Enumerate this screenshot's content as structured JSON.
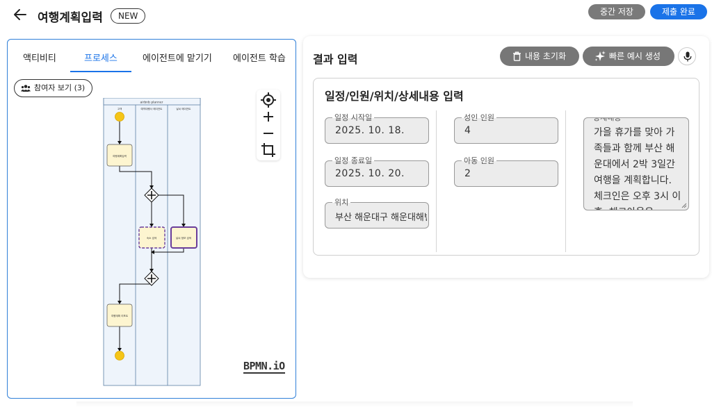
{
  "header": {
    "title": "여행계획입력",
    "badge": "NEW",
    "save_draft_label": "중간 저장",
    "submit_label": "제출 완료"
  },
  "left_panel": {
    "tabs": [
      {
        "label": "액티비티",
        "active": false
      },
      {
        "label": "프로세스",
        "active": true
      },
      {
        "label": "에이전트에 맡기기",
        "active": false
      },
      {
        "label": "에이전트 학습",
        "active": false
      }
    ],
    "participants_label": "참여자 보기 (3)",
    "diagram": {
      "pool_title": "airbnb planner",
      "lanes": [
        "고객",
        "예약대행사 에이전트",
        "날씨 에이전트"
      ],
      "tasks": {
        "travel_input": "여행계획입력",
        "accommodation": "숙소 검색",
        "weather": "날씨 정보 검색",
        "report": "여행계획 리포트"
      }
    },
    "logo": "BPMN.iO",
    "zoom_icons": [
      "target-icon",
      "plus-icon",
      "minus-icon",
      "crop-icon"
    ]
  },
  "right_panel": {
    "title": "결과 입력",
    "reset_label": "내용 초기화",
    "quick_label": "빠른 예시 생성",
    "form": {
      "title": "일정/인원/위치/상세내용 입력",
      "start_date": {
        "label": "일정 시작일",
        "value": "2025. 10. 18."
      },
      "end_date": {
        "label": "일정 종료일",
        "value": "2025. 10. 20."
      },
      "location": {
        "label": "위치",
        "value": "부산 해운대구 해운대해변로"
      },
      "adults": {
        "label": "성인 인원",
        "value": "4"
      },
      "children": {
        "label": "아동 인원",
        "value": "2"
      },
      "details": {
        "label": "상세내용",
        "value": "가을 휴가를 맞아 가족들과 함께 부산 해운대에서 2박 3일간 여행을 계획합니다. 체크인은 오후 3시 이후, 체크아웃은"
      }
    }
  },
  "colors": {
    "accent": "#1a73e8",
    "button_gray": "#777777",
    "task_fill": "#fdf5d0",
    "event_fill": "#f5c518",
    "highlight_stroke": "#6a3d9a"
  }
}
